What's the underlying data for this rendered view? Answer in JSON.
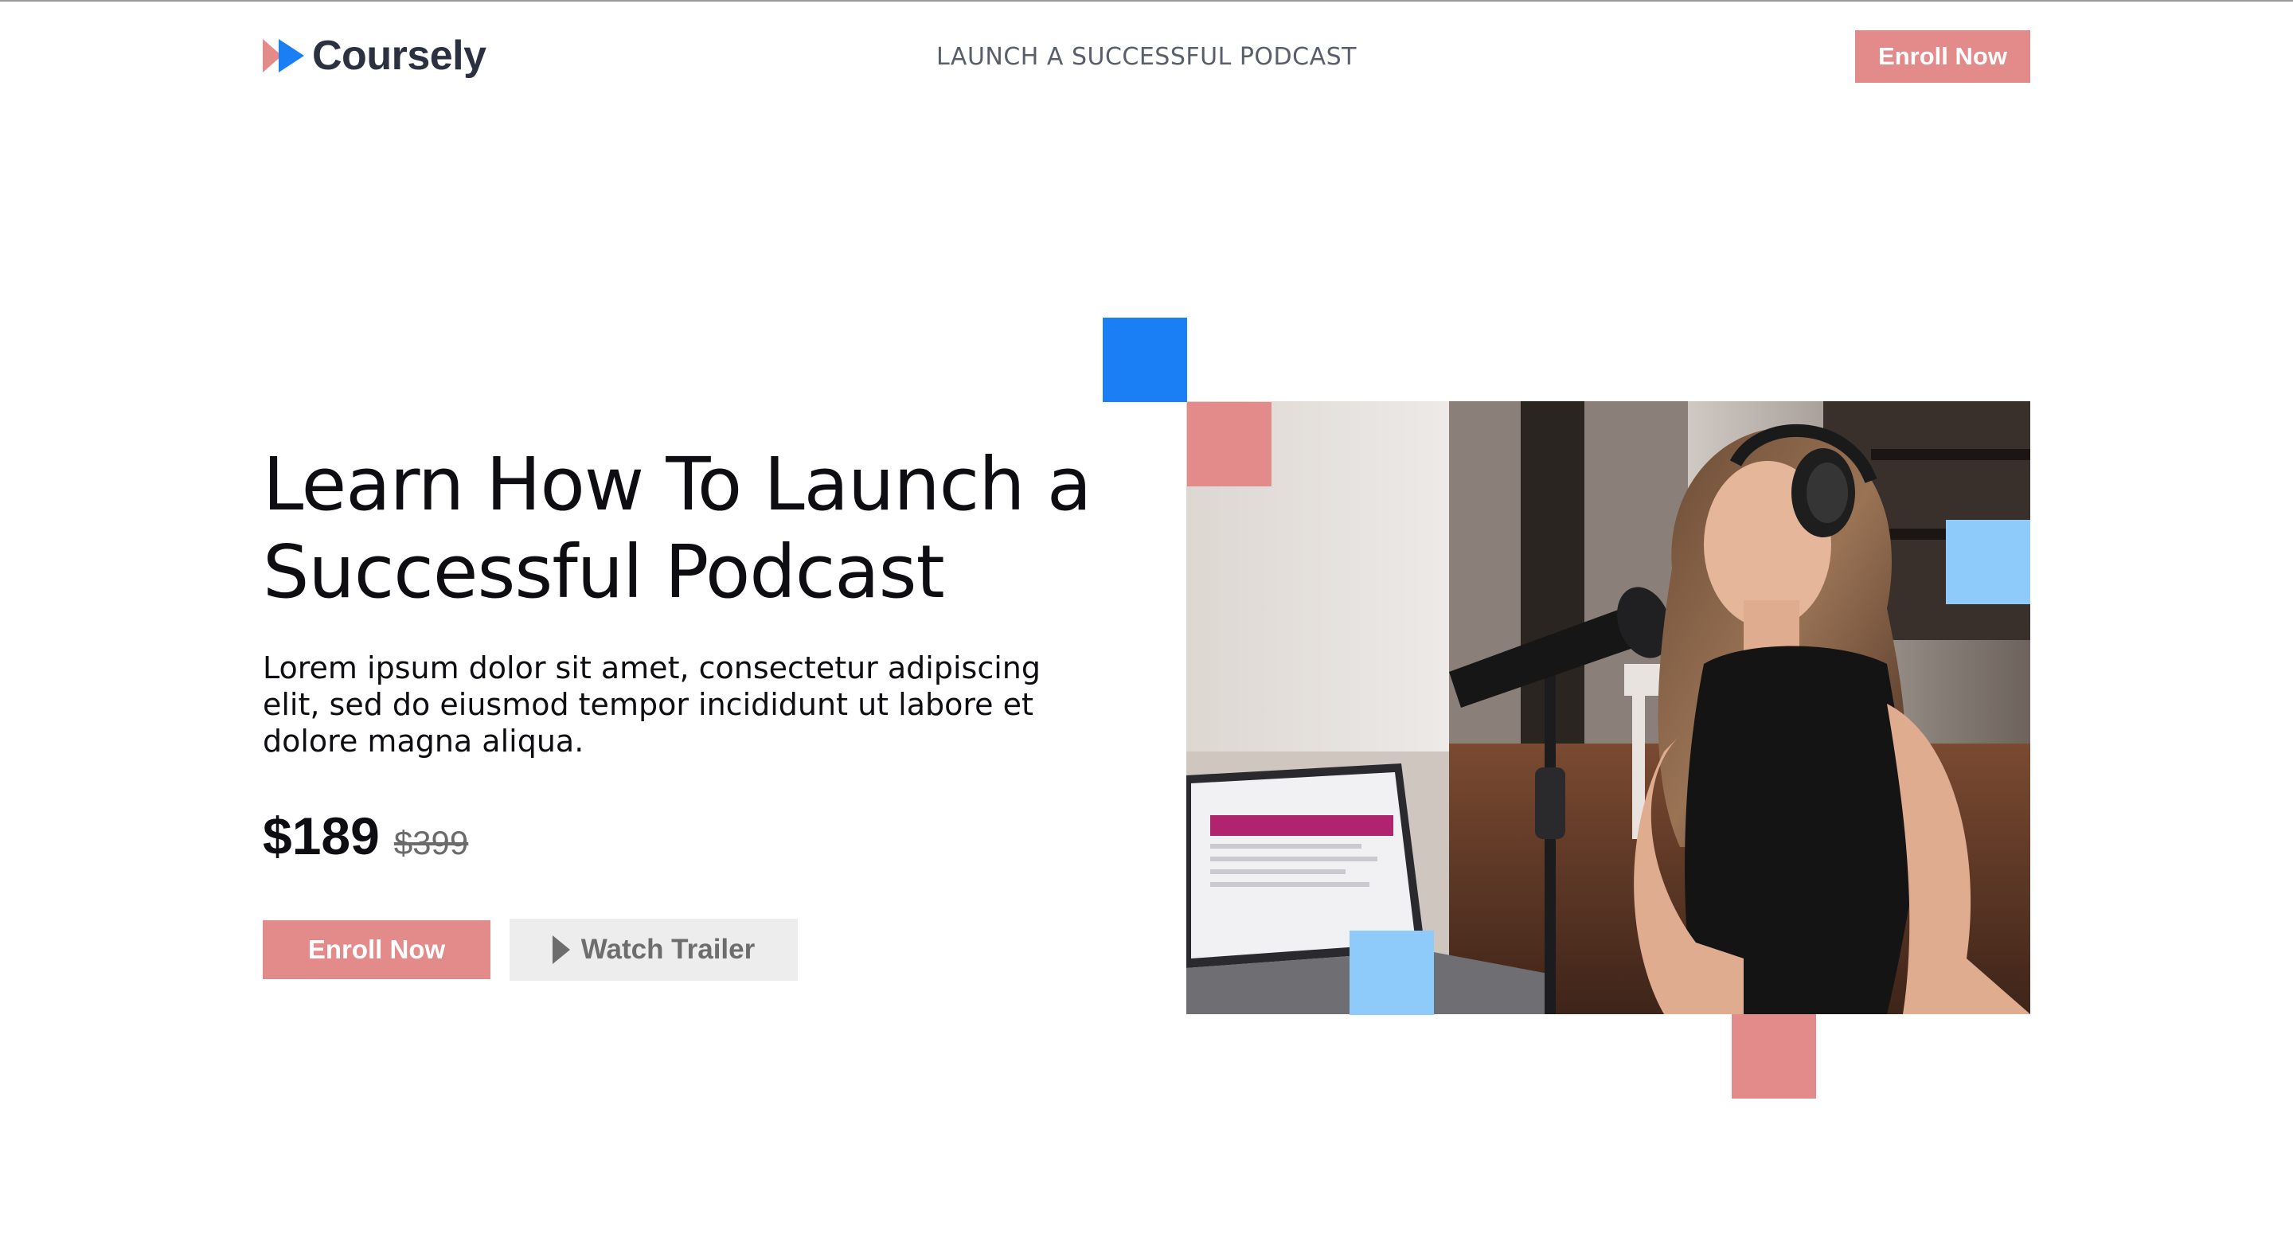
{
  "header": {
    "brand": "Coursely",
    "tagline": "LAUNCH A SUCCESSFUL PODCAST",
    "enroll_label": "Enroll Now"
  },
  "hero": {
    "title": "Learn How To Launch a Successful Podcast",
    "description": "Lorem ipsum dolor sit amet, consectetur adipiscing elit, sed do eiusmod tempor incididunt ut labore et dolore magna aliqua.",
    "price": "$189",
    "original_price": "$399",
    "enroll_label": "Enroll Now",
    "trailer_label": "Watch Trailer"
  },
  "colors": {
    "accent_pink": "#e38b8b",
    "accent_blue": "#1a7ff5",
    "accent_light_blue": "#8ecbfb",
    "text_dark": "#0d0d12",
    "button_gray": "#ededed"
  },
  "icons": {
    "logo": "fast-forward-icon",
    "trailer": "play-icon"
  }
}
